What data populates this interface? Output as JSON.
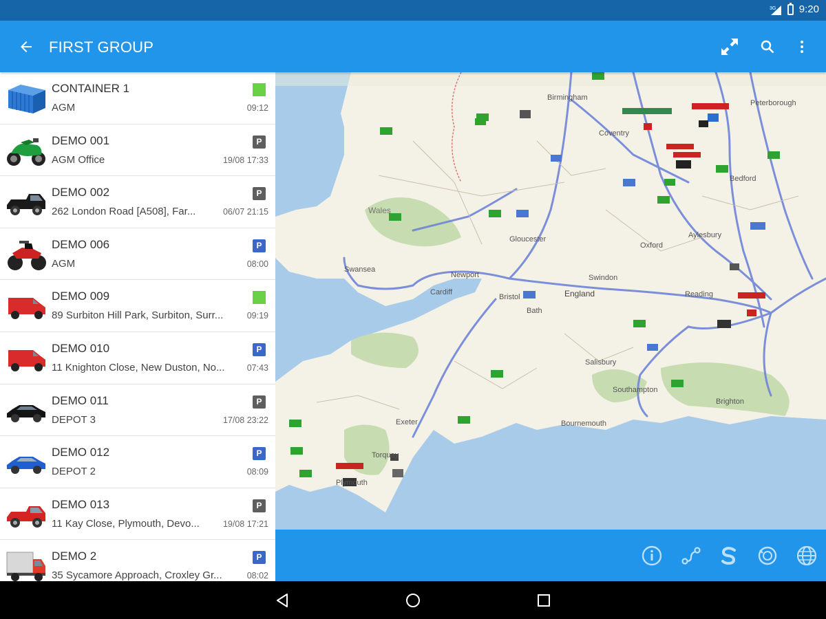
{
  "status_bar": {
    "network": "3G",
    "time": "9:20"
  },
  "app_bar": {
    "title": "FIRST GROUP",
    "icons": [
      "arrow-back-icon",
      "fullscreen-icon",
      "search-icon",
      "more-vert-icon"
    ]
  },
  "vehicles": [
    {
      "name": "CONTAINER 1",
      "address": "AGM",
      "time": "09:12",
      "status": "green",
      "icon": "container-icon"
    },
    {
      "name": "DEMO 001",
      "address": "AGM Office",
      "time": "19/08 17:33",
      "status": "parked-grey",
      "status_label": "P",
      "icon": "motorbike-icon"
    },
    {
      "name": "DEMO 002",
      "address": "262 London Road [A508], Far...",
      "time": "06/07 21:15",
      "status": "parked-grey",
      "status_label": "P",
      "icon": "pickup-icon"
    },
    {
      "name": "DEMO 006",
      "address": "AGM",
      "time": "08:00",
      "status": "parked-blue",
      "status_label": "P",
      "icon": "quad-bike-icon"
    },
    {
      "name": "DEMO 009",
      "address": "89 Surbiton Hill Park, Surbiton, Surr...",
      "time": "09:19",
      "status": "green",
      "icon": "van-icon"
    },
    {
      "name": "DEMO 010",
      "address": "11 Knighton Close, New Duston, No...",
      "time": "07:43",
      "status": "parked-blue",
      "status_label": "P",
      "icon": "van-icon"
    },
    {
      "name": "DEMO 011",
      "address": "DEPOT 3",
      "time": "17/08 23:22",
      "status": "parked-grey",
      "status_label": "P",
      "icon": "car-icon"
    },
    {
      "name": "DEMO 012",
      "address": "DEPOT 2",
      "time": "08:09",
      "status": "parked-blue",
      "status_label": "P",
      "icon": "car-icon"
    },
    {
      "name": "DEMO 013",
      "address": "11 Kay Close, Plymouth, Devo...",
      "time": "19/08 17:21",
      "status": "parked-grey",
      "status_label": "P",
      "icon": "pickup-icon"
    },
    {
      "name": "DEMO 2",
      "address": "35 Sycamore Approach, Croxley Gr...",
      "time": "08:02",
      "status": "parked-blue",
      "status_label": "P",
      "icon": "truck-icon"
    }
  ],
  "map": {
    "labels": [
      "Wales",
      "England",
      "Bristol",
      "Exeter",
      "Plymouth",
      "Bournemouth",
      "Reading",
      "Oxford",
      "Swansea",
      "Cardiff",
      "Newport",
      "Swindon",
      "Salisbury",
      "Southampton",
      "Aylesbury",
      "Bedford",
      "Peterborough",
      "Birmingham",
      "Coventry",
      "Gloucester",
      "Bath",
      "Torquay",
      "Brighton"
    ]
  },
  "bottom_bar": {
    "icons": [
      "info-icon",
      "route-icon",
      "speed-icon",
      "history-icon",
      "globe-icon"
    ]
  },
  "nav_bar": {
    "icons": [
      "nav-back-icon",
      "nav-home-icon",
      "nav-recents-icon"
    ]
  },
  "colors": {
    "primary": "#2195ea",
    "status_bar": "#1565a8",
    "status_green": "#6ad045",
    "parked_blue": "#3a67c9",
    "parked_grey": "#5e5e5e"
  }
}
